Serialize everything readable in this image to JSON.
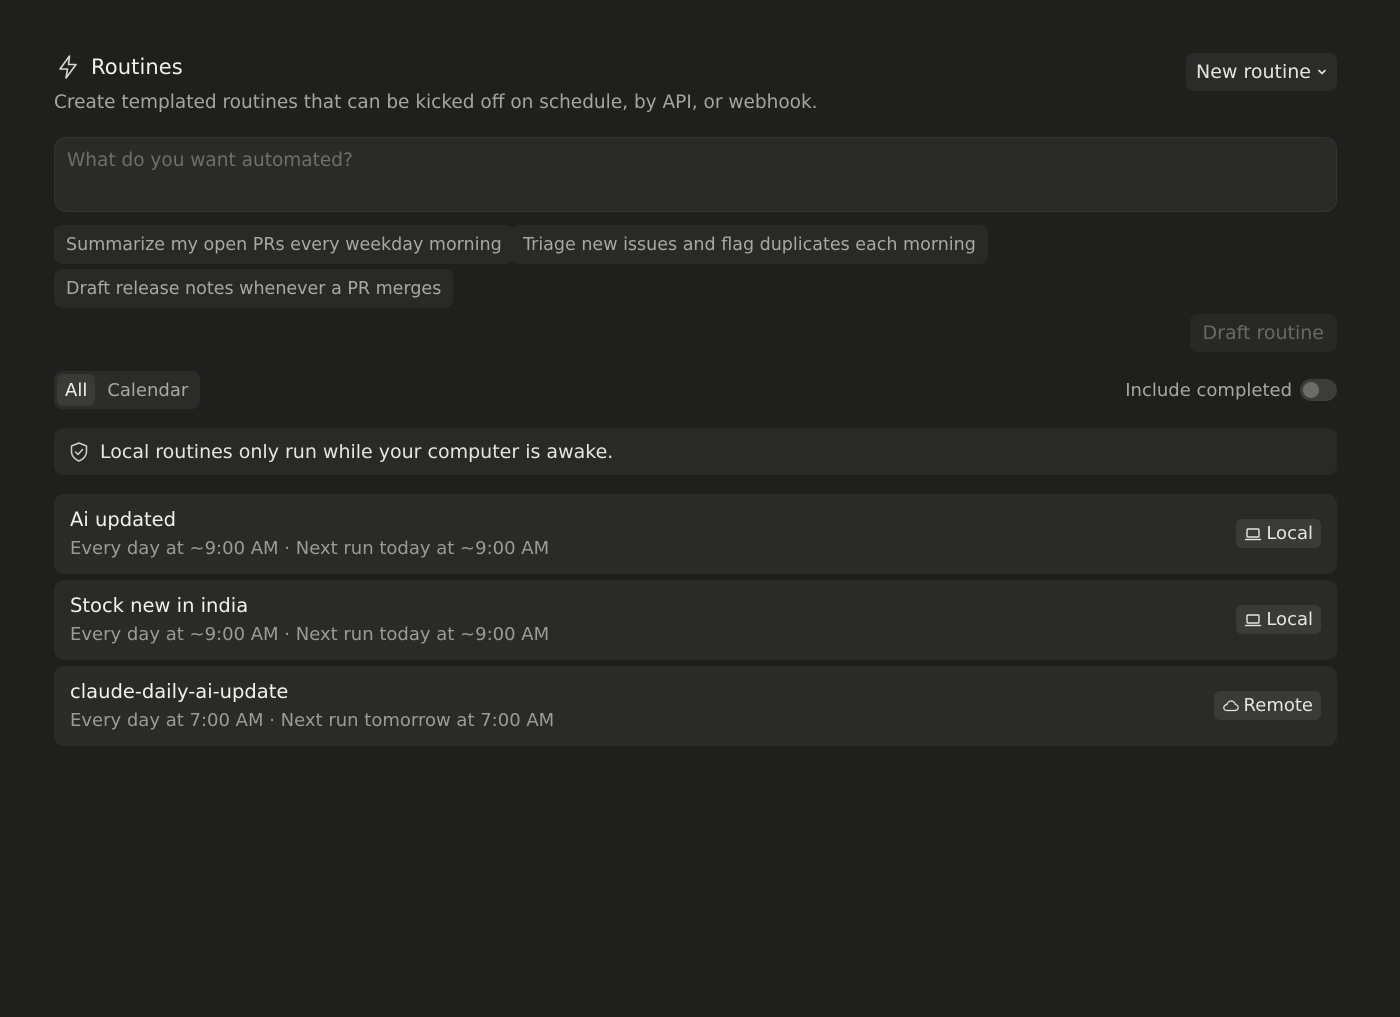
{
  "header": {
    "title": "Routines",
    "subtitle": "Create templated routines that can be kicked off on schedule, by API, or webhook.",
    "new_routine_label": "New routine"
  },
  "prompt": {
    "placeholder": "What do you want automated?"
  },
  "suggestions": [
    "Summarize my open PRs every weekday morning",
    "Triage new issues and flag duplicates each morning",
    "Draft release notes whenever a PR merges"
  ],
  "draft_label": "Draft routine",
  "tabs": [
    {
      "label": "All",
      "active": true
    },
    {
      "label": "Calendar",
      "active": false
    }
  ],
  "include_completed": {
    "label": "Include completed",
    "enabled": false
  },
  "notice": "Local routines only run while your computer is awake.",
  "routines": [
    {
      "name": "Ai updated",
      "schedule": "Every day at ~9:00 AM · Next run today at ~9:00 AM",
      "location": "Local",
      "icon": "laptop-icon"
    },
    {
      "name": "Stock new in india",
      "schedule": "Every day at ~9:00 AM · Next run today at ~9:00 AM",
      "location": "Local",
      "icon": "laptop-icon"
    },
    {
      "name": "claude-daily-ai-update",
      "schedule": "Every day at 7:00 AM · Next run tomorrow at 7:00 AM",
      "location": "Remote",
      "icon": "cloud-icon"
    }
  ],
  "colors": {
    "background": "#1f1f1e",
    "card": "#2a2a28",
    "text_primary": "#f2f1ec",
    "text_secondary": "#9c9a94"
  }
}
